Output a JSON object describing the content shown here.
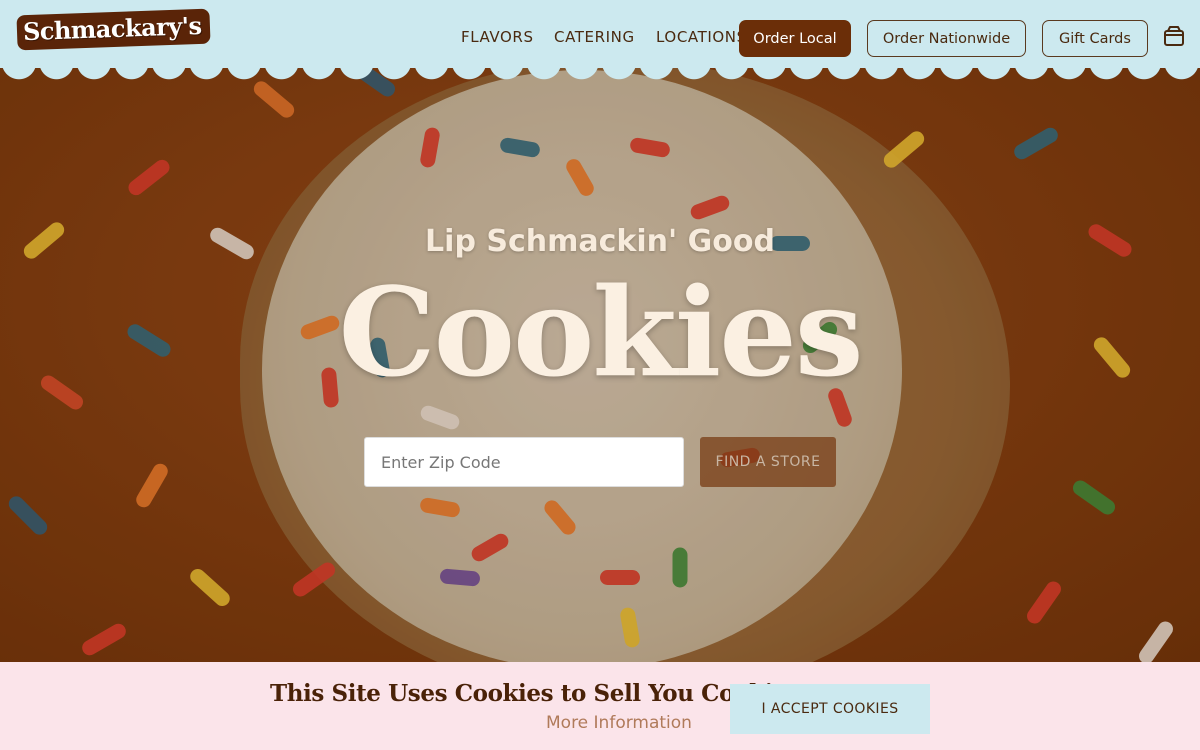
{
  "header": {
    "logo": "Schmackary's",
    "nav": [
      {
        "label": "FLAVORS"
      },
      {
        "label": "CATERING"
      },
      {
        "label": "LOCATIONS"
      }
    ],
    "buttons": {
      "order_local": "Order Local",
      "order_nationwide": "Order Nationwide",
      "gift_cards": "Gift Cards"
    },
    "cart_icon": "shopping-bag-icon"
  },
  "hero": {
    "subtitle": "Lip Schmackin' Good",
    "headline": "Cookies",
    "zip_placeholder": "Enter Zip Code",
    "find_button": "FIND A STORE"
  },
  "cookie_banner": {
    "title": "This Site Uses Cookies to Sell You Cookies.",
    "more_info": "More Information",
    "accept": "I ACCEPT COOKIES"
  },
  "colors": {
    "header_bg": "#cce9ef",
    "brand_brown": "#6b2e08",
    "banner_bg": "#fbe4ea",
    "accent_light_blue": "#cce9ef"
  }
}
